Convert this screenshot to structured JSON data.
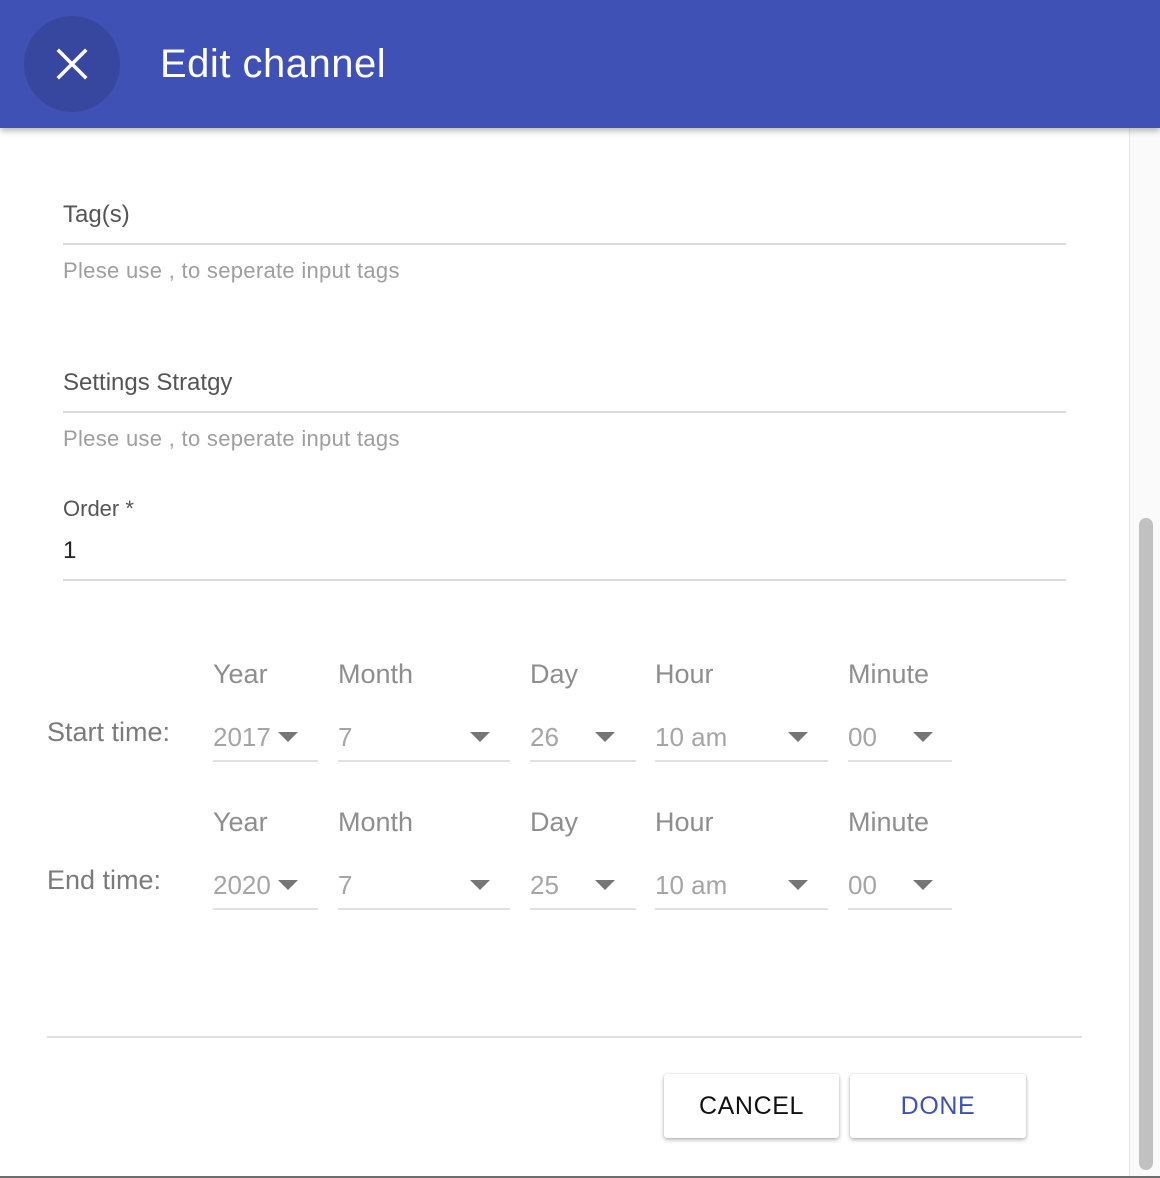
{
  "header": {
    "title": "Edit channel",
    "close_icon": "close-icon",
    "background_color": "#3f51b5"
  },
  "fields": {
    "tags": {
      "label": "Tag(s)",
      "value": "",
      "hint": "Plese use , to seperate input tags"
    },
    "settings_strategy": {
      "label": "Settings Stratgy",
      "value": "",
      "hint": "Plese use , to seperate input tags"
    },
    "order": {
      "label": "Order *",
      "value": "1"
    }
  },
  "time": {
    "columns": {
      "year": "Year",
      "month": "Month",
      "day": "Day",
      "hour": "Hour",
      "minute": "Minute"
    },
    "start": {
      "label": "Start time:",
      "year": "2017",
      "month": "7",
      "day": "26",
      "hour": "10 am",
      "minute": "00"
    },
    "end": {
      "label": "End time:",
      "year": "2020",
      "month": "7",
      "day": "25",
      "hour": "10 am",
      "minute": "00"
    }
  },
  "actions": {
    "cancel": "CANCEL",
    "done": "DONE",
    "done_color": "#3f51b5"
  }
}
